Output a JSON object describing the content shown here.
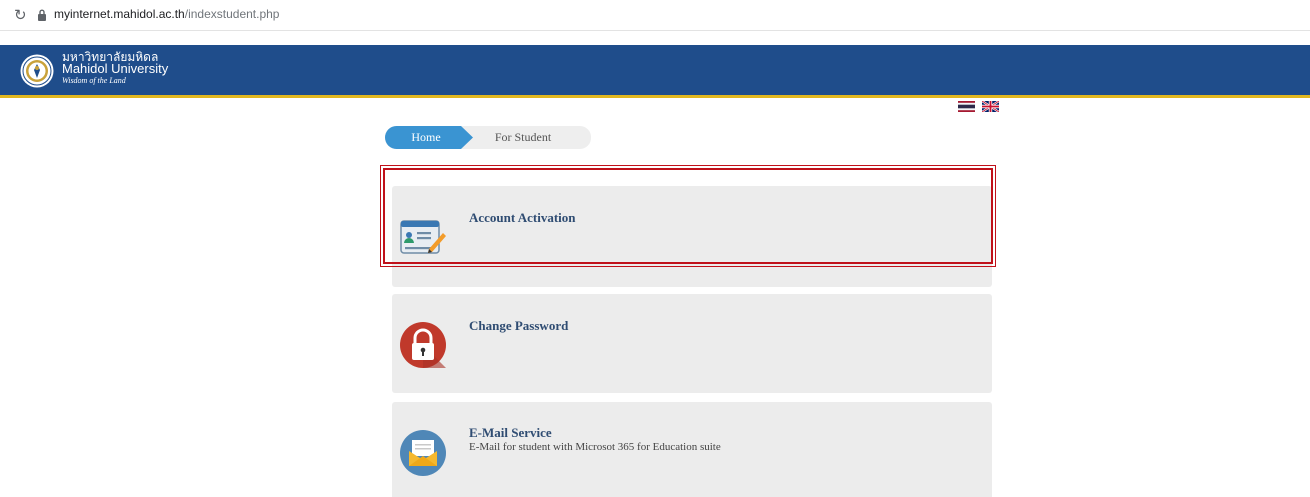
{
  "browser": {
    "url_host": "myinternet.mahidol.ac.th",
    "url_path": "/indexstudent.php",
    "reload_icon": "↻"
  },
  "header": {
    "logo_thai": "มหาวิทยาลัยมหิดล",
    "logo_en": "Mahidol University",
    "logo_motto": "Wisdom of the Land",
    "brand_color": "#1f4d8b",
    "accent_color": "#e1b71f"
  },
  "languages": {
    "thai_flag_icon": "thai-flag-icon",
    "uk_flag_icon": "uk-flag-icon"
  },
  "breadcrumb": {
    "home": "Home",
    "current": "For Student",
    "home_color": "#3a94d2"
  },
  "services": [
    {
      "title": "Account Activation",
      "description": "",
      "icon": "id-card-icon",
      "highlighted": true
    },
    {
      "title": "Change Password",
      "description": "",
      "icon": "padlock-icon"
    },
    {
      "title": "E-Mail Service",
      "description": "E-Mail for student with Microsot 365 for Education suite",
      "icon": "envelope-icon"
    }
  ],
  "highlight_color": "#c0111a"
}
